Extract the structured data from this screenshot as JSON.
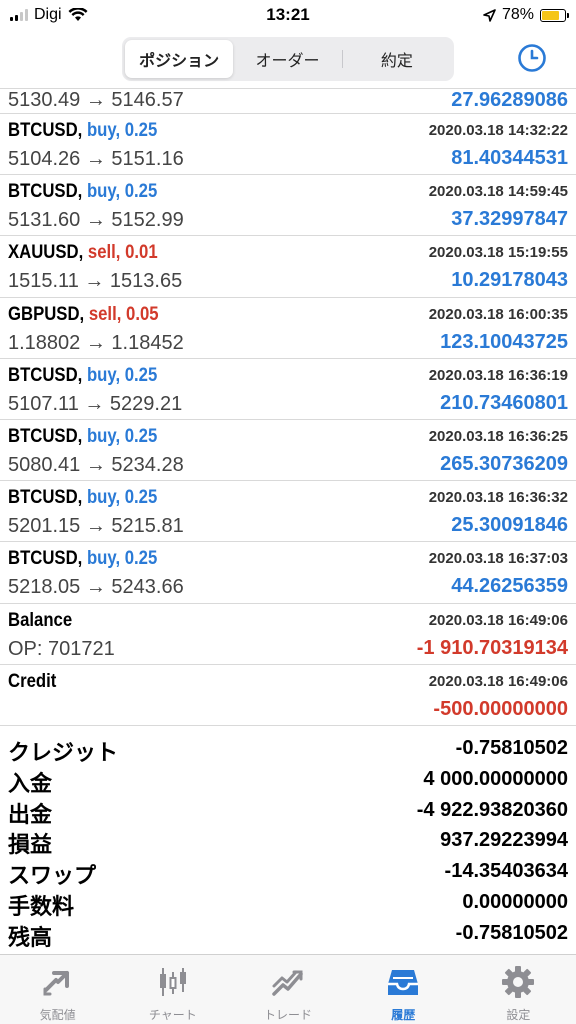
{
  "status": {
    "carrier": "Digi",
    "time": "13:21",
    "battery": "78%",
    "battery_level": 0.78
  },
  "tabs": [
    "ポジション",
    "オーダー",
    "約定"
  ],
  "rows": [
    {
      "left2": "5130.49 → 5146.57",
      "right2": "27.96289086",
      "right2_color": "blue",
      "first": true
    },
    {
      "symbol": "BTCUSD,",
      "side": "buy, 0.25",
      "side_color": "blue",
      "time": "2020.03.18 14:32:22",
      "left2": "5104.26 → 5151.16",
      "right2": "81.40344531",
      "right2_color": "blue"
    },
    {
      "symbol": "BTCUSD,",
      "side": "buy, 0.25",
      "side_color": "blue",
      "time": "2020.03.18 14:59:45",
      "left2": "5131.60 → 5152.99",
      "right2": "37.32997847",
      "right2_color": "blue"
    },
    {
      "symbol": "XAUUSD,",
      "side": "sell, 0.01",
      "side_color": "red",
      "time": "2020.03.18 15:19:55",
      "left2": "1515.11 → 1513.65",
      "right2": "10.29178043",
      "right2_color": "blue"
    },
    {
      "symbol": "GBPUSD,",
      "side": "sell, 0.05",
      "side_color": "red",
      "time": "2020.03.18 16:00:35",
      "left2": "1.18802 → 1.18452",
      "right2": "123.10043725",
      "right2_color": "blue"
    },
    {
      "symbol": "BTCUSD,",
      "side": "buy, 0.25",
      "side_color": "blue",
      "time": "2020.03.18 16:36:19",
      "left2": "5107.11 → 5229.21",
      "right2": "210.73460801",
      "right2_color": "blue"
    },
    {
      "symbol": "BTCUSD,",
      "side": "buy, 0.25",
      "side_color": "blue",
      "time": "2020.03.18 16:36:25",
      "left2": "5080.41 → 5234.28",
      "right2": "265.30736209",
      "right2_color": "blue"
    },
    {
      "symbol": "BTCUSD,",
      "side": "buy, 0.25",
      "side_color": "blue",
      "time": "2020.03.18 16:36:32",
      "left2": "5201.15 → 5215.81",
      "right2": "25.30091846",
      "right2_color": "blue"
    },
    {
      "symbol": "BTCUSD,",
      "side": "buy, 0.25",
      "side_color": "blue",
      "time": "2020.03.18 16:37:03",
      "left2": "5218.05 → 5243.66",
      "right2": "44.26256359",
      "right2_color": "blue"
    },
    {
      "symbol": "Balance",
      "side": "",
      "side_color": "blue",
      "time": "2020.03.18 16:49:06",
      "left2": "OP: 701721",
      "right2": "-1 910.70319134",
      "right2_color": "red"
    },
    {
      "symbol": "Credit",
      "side": "",
      "side_color": "blue",
      "time": "2020.03.18 16:49:06",
      "left2": "",
      "right2": "-500.00000000",
      "right2_color": "red"
    }
  ],
  "summary": [
    {
      "label": "クレジット",
      "value": "-0.75810502"
    },
    {
      "label": "入金",
      "value": "4 000.00000000"
    },
    {
      "label": "出金",
      "value": "-4 922.93820360"
    },
    {
      "label": "損益",
      "value": "937.29223994"
    },
    {
      "label": "スワップ",
      "value": "-14.35403634"
    },
    {
      "label": "手数料",
      "value": "0.00000000"
    },
    {
      "label": "残高",
      "value": "-0.75810502"
    }
  ],
  "tabbar": [
    {
      "label": "気配値",
      "icon": "quotes-icon"
    },
    {
      "label": "チャート",
      "icon": "chart-icon"
    },
    {
      "label": "トレード",
      "icon": "trade-icon"
    },
    {
      "label": "履歴",
      "icon": "history-icon",
      "active": true
    },
    {
      "label": "設定",
      "icon": "settings-icon"
    }
  ],
  "colors": {
    "accent": "#2a7ad6",
    "negative": "#d23a2b",
    "inactive": "#8e8e93"
  }
}
